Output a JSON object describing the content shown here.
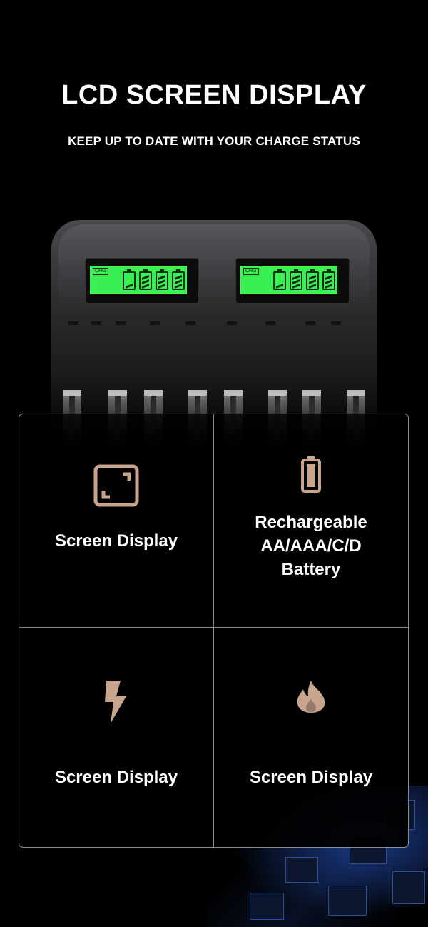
{
  "header": {
    "title": "LCD SCREEN DISPLAY",
    "subtitle": "KEEP UP TO DATE WITH YOUR CHARGE STATUS"
  },
  "charger": {
    "lcd_left": {
      "tag": "CHG"
    },
    "lcd_right": {
      "tag": "CHG"
    },
    "lcd_color": "#38f052"
  },
  "features": [
    {
      "label": "Screen Display",
      "icon": "screen-frame-icon"
    },
    {
      "label_lines": [
        "Rechargeable",
        "AA/AAA/C/D",
        "Battery"
      ],
      "icon": "battery-icon"
    },
    {
      "label": "Screen Display",
      "icon": "lightning-icon"
    },
    {
      "label": "Screen Display",
      "icon": "flame-icon"
    }
  ],
  "colors": {
    "background": "#000000",
    "accent_icon": "#c9a58e",
    "grid_border": "#8a8a8a",
    "text": "#ffffff"
  }
}
